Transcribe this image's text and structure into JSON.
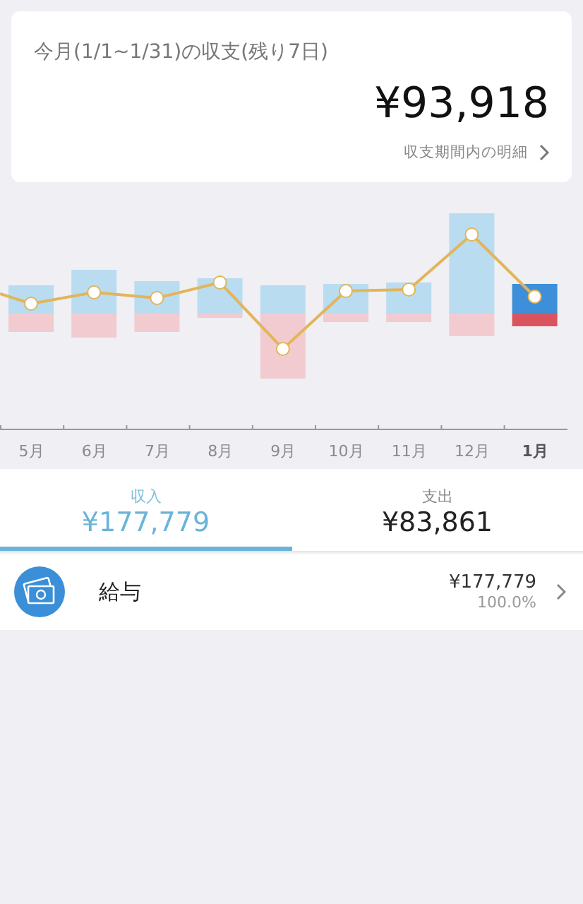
{
  "summary": {
    "title": "今月(1/1~1/31)の収支(残り7日)",
    "amount": "¥93,918",
    "link": "収支期間内の明細"
  },
  "months": [
    {
      "label": "5月",
      "selected": false
    },
    {
      "label": "6月",
      "selected": false
    },
    {
      "label": "7月",
      "selected": false
    },
    {
      "label": "8月",
      "selected": false
    },
    {
      "label": "9月",
      "selected": false
    },
    {
      "label": "10月",
      "selected": false
    },
    {
      "label": "11月",
      "selected": false
    },
    {
      "label": "12月",
      "selected": false
    },
    {
      "label": "1月",
      "selected": true
    }
  ],
  "tabs": [
    {
      "label": "収入",
      "amount": "¥177,779",
      "selected": true
    },
    {
      "label": "支出",
      "amount": "¥83,861",
      "selected": false
    }
  ],
  "categories": [
    {
      "name": "給与",
      "amount": "¥177,779",
      "share": "100.0%"
    }
  ]
}
